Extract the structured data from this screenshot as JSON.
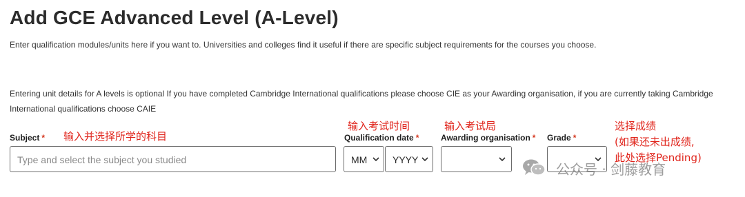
{
  "header": {
    "title": "Add GCE Advanced Level (A-Level)",
    "subtitle": "Enter qualification modules/units here if you want to. Universities and colleges find it useful if there are specific subject requirements for the courses you choose."
  },
  "note": {
    "text": "Entering unit details for A levels is optional If you have completed Cambridge International qualifications please choose CIE as your Awarding organisation, if you are currently taking Cambridge International qualifications choose CAIE"
  },
  "form": {
    "required_mark": "*",
    "subject": {
      "label": "Subject",
      "placeholder": "Type and select the subject you studied"
    },
    "qualification_date": {
      "label": "Qualification date",
      "month_value": "MM",
      "year_value": "YYYY"
    },
    "awarding_organisation": {
      "label": "Awarding organisation",
      "value": ""
    },
    "grade": {
      "label": "Grade",
      "value": ""
    }
  },
  "annotations": {
    "subject": "输入并选择所学的科目",
    "qualification_date": "输入考试时间",
    "awarding_organisation": "输入考试局",
    "grade_line1": "选择成绩",
    "grade_line2": "(如果还未出成绩,",
    "grade_line3": "此处选择Pending)"
  },
  "watermark": {
    "text": "公众号 · 剑藤教育",
    "icon": "wechat-icon"
  },
  "colors": {
    "required": "#d4351c",
    "annotation": "#e0241b",
    "border": "#6b6b6b",
    "placeholder": "#8a8a8a"
  }
}
